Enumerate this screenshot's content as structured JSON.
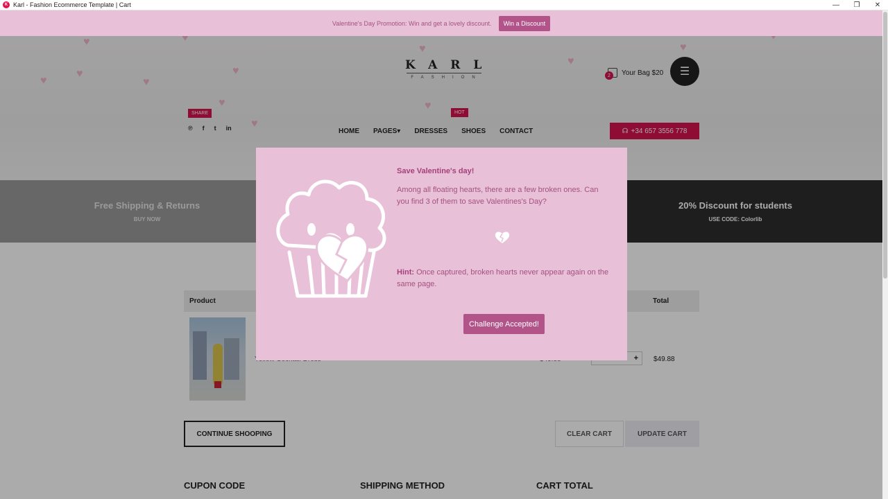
{
  "window": {
    "title": "Karl - Fashion Ecommerce Template | Cart",
    "favicon": "K",
    "minimize": "—",
    "restore": "❐",
    "close": "✕"
  },
  "promo": {
    "text": "Valentine's Day Promotion: Win and get a lovely discount.",
    "button": "Win a Discount"
  },
  "header": {
    "logo_main": "KARL",
    "logo_sub": "FASHION",
    "bag_label": "Your Bag $20",
    "bag_count": "2",
    "share_tag": "SHARE",
    "hot_tag": "HOT",
    "socials": [
      "pinterest-icon",
      "facebook-icon",
      "twitter-icon",
      "linkedin-icon"
    ],
    "social_glyphs": [
      "℗",
      "f",
      "t",
      "in"
    ],
    "nav": [
      "HOME",
      "PAGES",
      "DRESSES",
      "SHOES",
      "CONTACT"
    ],
    "pages_caret": "▾",
    "phone": "+34 657 3556 778"
  },
  "features": [
    {
      "title": "Free Shipping & Returns",
      "sub": "BUY NOW"
    },
    {
      "title": "",
      "sub": ""
    },
    {
      "title": "20% Discount for students",
      "sub": "USE CODE: Colorlib"
    }
  ],
  "cart": {
    "col_product": "Product",
    "col_total": "Total",
    "rows": [
      {
        "name": "Yellow Cocktail Dress",
        "price": "$49.88",
        "qty_minus": "-",
        "qty_plus": "+",
        "total": "$49.88"
      }
    ],
    "continue": "CONTINUE SHOOPING",
    "clear": "CLEAR CART",
    "update": "UPDATE CART"
  },
  "sections": {
    "coupon": "CUPON CODE",
    "shipping": "SHIPPING METHOD",
    "total": "CART TOTAL"
  },
  "modal": {
    "title": "Save Valentine's day!",
    "text": "Among all floating hearts, there are a few broken ones. Can you find 3 of them to save Valentines's Day?",
    "hint_label": "Hint:",
    "hint_text": " Once captured, broken hearts never appear again on the same page.",
    "button": "Challenge Accepted!"
  },
  "colors": {
    "promo_bg": "#e8c1d9",
    "accent_pink": "#b2548a",
    "brand_red": "#d6124f"
  }
}
